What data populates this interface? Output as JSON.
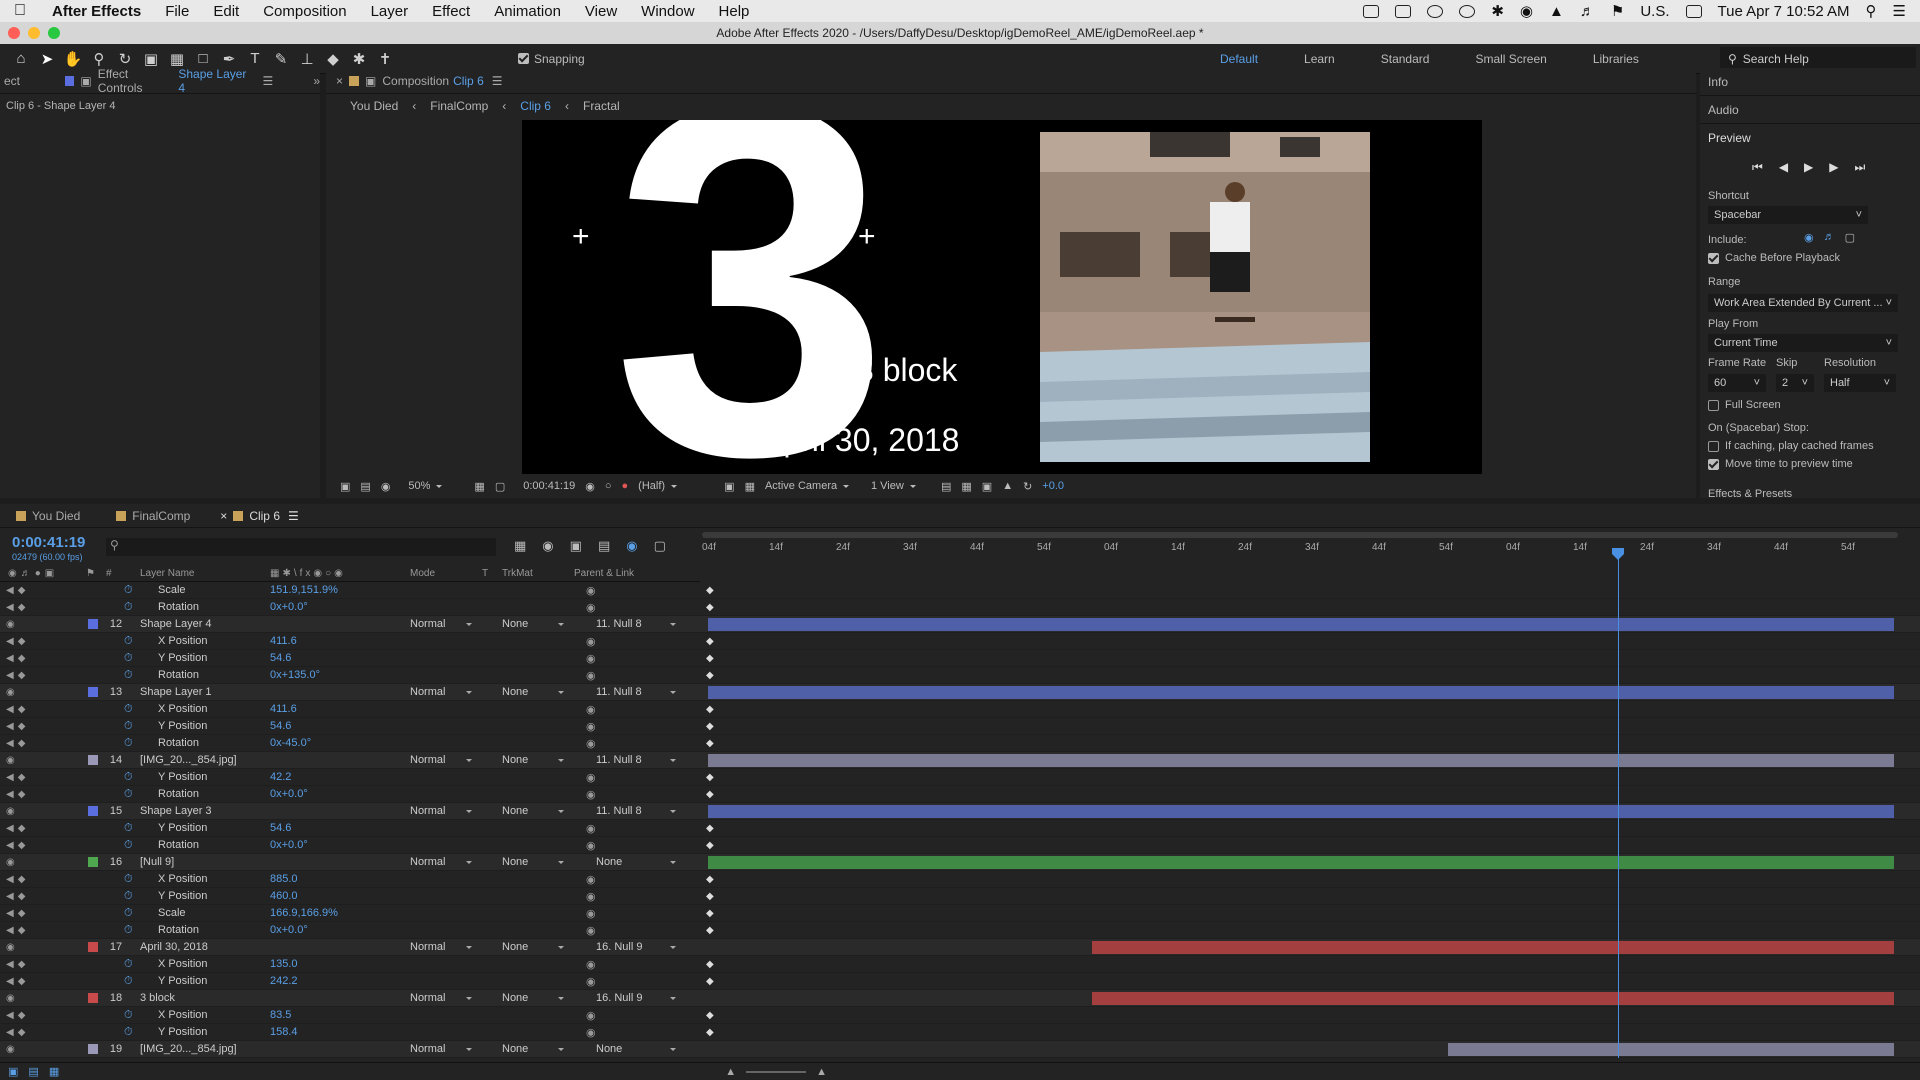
{
  "menubar": {
    "app": "After Effects",
    "items": [
      "File",
      "Edit",
      "Composition",
      "Layer",
      "Effect",
      "Animation",
      "View",
      "Window",
      "Help"
    ],
    "locale": "U.S.",
    "clock": "Tue Apr 7  10:52 AM"
  },
  "window_title": "Adobe After Effects 2020 - /Users/DaffyDesu/Desktop/igDemoReel_AME/igDemoReel.aep *",
  "toolbar": {
    "snapping": "Snapping",
    "workspaces": [
      "Default",
      "Learn",
      "Standard",
      "Small Screen",
      "Libraries"
    ],
    "search_placeholder": "Search Help"
  },
  "left_panel": {
    "tab_cut": "ect",
    "tab_prefix": "Effect Controls",
    "tab_layer": "Shape Layer 4",
    "subtitle": "Clip 6 - Shape Layer 4"
  },
  "comp_panel": {
    "tab_prefix": "Composition",
    "tab_name": "Clip 6",
    "breadcrumbs": [
      "You Died",
      "FinalComp",
      "Clip 6",
      "Fractal"
    ]
  },
  "viewer": {
    "big_number": "3",
    "text_block": "3 block",
    "text_date": "April 30, 2018"
  },
  "viewer_bar": {
    "zoom": "50%",
    "time": "0:00:41:19",
    "resolution": "(Half)",
    "camera": "Active Camera",
    "views": "1 View",
    "exposure": "+0.0"
  },
  "right_panel": {
    "info": "Info",
    "audio": "Audio",
    "preview": "Preview",
    "shortcut_label": "Shortcut",
    "shortcut": "Spacebar",
    "include_label": "Include:",
    "cache_before": "Cache Before Playback",
    "range_label": "Range",
    "range": "Work Area Extended By Current ...",
    "playfrom_label": "Play From",
    "playfrom": "Current Time",
    "framerate_label": "Frame Rate",
    "skip_label": "Skip",
    "resolution_label": "Resolution",
    "framerate": "60",
    "skip": "2",
    "resolution": "Half",
    "fullscreen": "Full Screen",
    "onstop": "On (Spacebar) Stop:",
    "ifcaching": "If caching, play cached frames",
    "movetime": "Move time to preview time",
    "effects": "Effects & Presets"
  },
  "timeline": {
    "tabs": [
      "You Died",
      "FinalComp",
      "Clip 6"
    ],
    "timecode": "0:00:41:19",
    "fps": "02479 (60.00 fps)",
    "col_layer": "Layer Name",
    "col_mode": "Mode",
    "col_t": "T",
    "col_trkmat": "TrkMat",
    "col_parent": "Parent & Link",
    "col_num": "#",
    "ruler": [
      "04f",
      "14f",
      "24f",
      "34f",
      "44f",
      "54f",
      "04f",
      "14f",
      "24f",
      "34f",
      "44f",
      "54f",
      "04f",
      "14f",
      "24f",
      "34f",
      "44f",
      "54f"
    ],
    "rows": [
      {
        "t": "p",
        "name": "Scale",
        "val": "151.9,151.9%"
      },
      {
        "t": "p",
        "name": "Rotation",
        "val": "0x+0.0°"
      },
      {
        "t": "l",
        "num": "12",
        "name": "Shape Layer 4",
        "mode": "Normal",
        "trk": "None",
        "par": "11. Null 8"
      },
      {
        "t": "p",
        "name": "X Position",
        "val": "411.6"
      },
      {
        "t": "p",
        "name": "Y Position",
        "val": "54.6"
      },
      {
        "t": "p",
        "name": "Rotation",
        "val": "0x+135.0°"
      },
      {
        "t": "l",
        "num": "13",
        "name": "Shape Layer 1",
        "mode": "Normal",
        "trk": "None",
        "par": "11. Null 8"
      },
      {
        "t": "p",
        "name": "X Position",
        "val": "411.6"
      },
      {
        "t": "p",
        "name": "Y Position",
        "val": "54.6"
      },
      {
        "t": "p",
        "name": "Rotation",
        "val": "0x-45.0°"
      },
      {
        "t": "l",
        "num": "14",
        "name": "[IMG_20..._854.jpg]",
        "mode": "Normal",
        "trk": "None",
        "par": "11. Null 8"
      },
      {
        "t": "p",
        "name": "Y Position",
        "val": "42.2"
      },
      {
        "t": "p",
        "name": "Rotation",
        "val": "0x+0.0°"
      },
      {
        "t": "l",
        "num": "15",
        "name": "Shape Layer 3",
        "mode": "Normal",
        "trk": "None",
        "par": "11. Null 8"
      },
      {
        "t": "p",
        "name": "Y Position",
        "val": "54.6"
      },
      {
        "t": "p",
        "name": "Rotation",
        "val": "0x+0.0°"
      },
      {
        "t": "l",
        "num": "16",
        "name": "[Null 9]",
        "mode": "Normal",
        "trk": "None",
        "par": "None"
      },
      {
        "t": "p",
        "name": "X Position",
        "val": "885.0"
      },
      {
        "t": "p",
        "name": "Y Position",
        "val": "460.0"
      },
      {
        "t": "p",
        "name": "Scale",
        "val": "166.9,166.9%"
      },
      {
        "t": "p",
        "name": "Rotation",
        "val": "0x+0.0°"
      },
      {
        "t": "l",
        "num": "17",
        "name": "April 30, 2018",
        "mode": "Normal",
        "trk": "None",
        "par": "16. Null 9"
      },
      {
        "t": "p",
        "name": "X Position",
        "val": "135.0"
      },
      {
        "t": "p",
        "name": "Y Position",
        "val": "242.2"
      },
      {
        "t": "l",
        "num": "18",
        "name": "3 block",
        "mode": "Normal",
        "trk": "None",
        "par": "16. Null 9"
      },
      {
        "t": "p",
        "name": "X Position",
        "val": "83.5"
      },
      {
        "t": "p",
        "name": "Y Position",
        "val": "158.4"
      },
      {
        "t": "l",
        "num": "19",
        "name": "[IMG_20..._854.jpg]",
        "mode": "Normal",
        "trk": "None",
        "par": "None"
      }
    ]
  }
}
